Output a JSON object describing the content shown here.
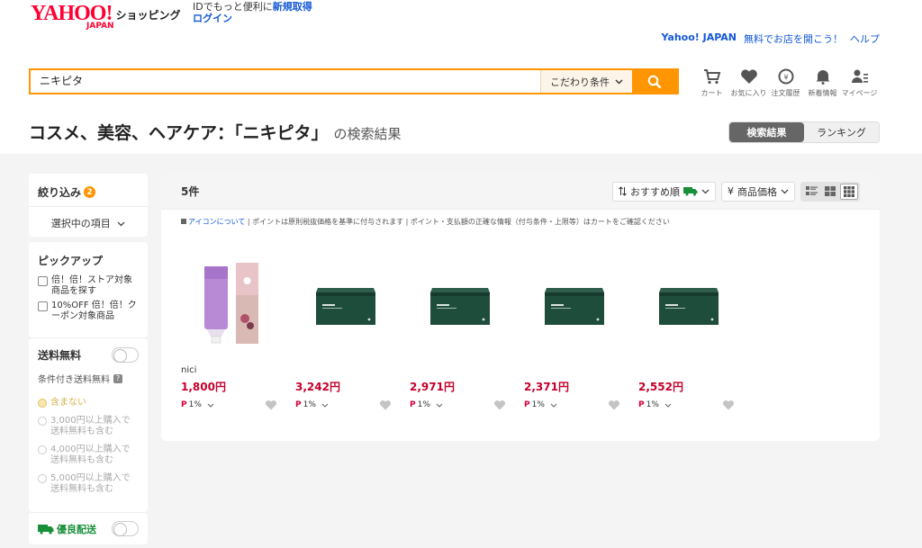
{
  "header": {
    "logo_main": "YAHOO!",
    "logo_sub": "JAPAN",
    "logo_shop": "ショッピング",
    "id_text": "IDでもっと便利に",
    "register_link": "新規取得",
    "login_link": "ログイン",
    "yahoo_japan": "Yahoo! JAPAN",
    "open_store": "無料でお店を開こう！",
    "help": "ヘルプ"
  },
  "search": {
    "query": "ニキピタ",
    "condition_label": "こだわり条件"
  },
  "header_icons": [
    {
      "label": "カート",
      "icon": "cart-icon"
    },
    {
      "label": "お気に入り",
      "icon": "heart-icon"
    },
    {
      "label": "注文履歴",
      "icon": "order-history-icon"
    },
    {
      "label": "新着情報",
      "icon": "bell-icon"
    },
    {
      "label": "マイページ",
      "icon": "user-icon"
    }
  ],
  "page": {
    "title": "コスメ、美容、ヘアケア：「ニキピタ」",
    "title_suffix": "の検索結果",
    "tab_results": "検索結果",
    "tab_ranking": "ランキング"
  },
  "sidebar": {
    "filter_title": "絞り込み",
    "filter_count": "2",
    "selected_items": "選択中の項目",
    "pickup_title": "ピックアップ",
    "pickup_items": [
      "倍！倍！ストア対象商品を探す",
      "10%OFF 倍！倍！クーポン対象商品"
    ],
    "free_shipping": "送料無料",
    "conditional_free": "条件付き送料無料",
    "shipping_options": [
      "含まない",
      "3,000円以上購入で送料無料も含む",
      "4,000円以上購入で送料無料も含む",
      "5,000円以上購入で送料無料も含む"
    ],
    "fast_delivery": "優良配送"
  },
  "results": {
    "count": "5件",
    "sort_label": "おすすめ順",
    "price_sort_label": "商品価格",
    "notice_link": "アイコンについて",
    "notice_text": "ポイントは原則税抜価格を基準に付与されます | ポイント・支払額の正確な情報（付与条件・上限等）はカートをご確認ください",
    "items": [
      {
        "brand": "nici",
        "price": "1,800円",
        "point": "1%"
      },
      {
        "brand": "",
        "price": "3,242円",
        "point": "1%"
      },
      {
        "brand": "",
        "price": "2,971円",
        "point": "1%"
      },
      {
        "brand": "",
        "price": "2,371円",
        "point": "1%"
      },
      {
        "brand": "",
        "price": "2,552円",
        "point": "1%"
      }
    ]
  },
  "colors": {
    "brand_red": "#ff0033",
    "accent_orange": "#ff9500",
    "price_red": "#c5002b",
    "link_blue": "#1358d6"
  }
}
